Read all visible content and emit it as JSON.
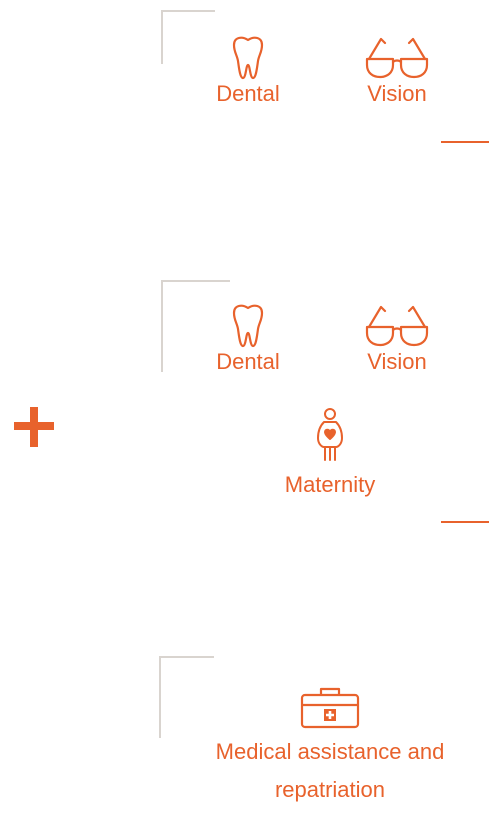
{
  "colors": {
    "accent": "#e8622c",
    "frame": "#d9d4cf"
  },
  "section1": {
    "items": [
      {
        "label": "Dental",
        "icon": "tooth-icon"
      },
      {
        "label": "Vision",
        "icon": "glasses-icon"
      }
    ]
  },
  "section2": {
    "items": [
      {
        "label": "Dental",
        "icon": "tooth-icon"
      },
      {
        "label": "Vision",
        "icon": "glasses-icon"
      },
      {
        "label": "Maternity",
        "icon": "maternity-icon"
      }
    ]
  },
  "plus_icon": "plus-icon",
  "section3": {
    "items": [
      {
        "label": "Medical assistance and repatriation",
        "icon": "medical-kit-icon"
      }
    ]
  }
}
